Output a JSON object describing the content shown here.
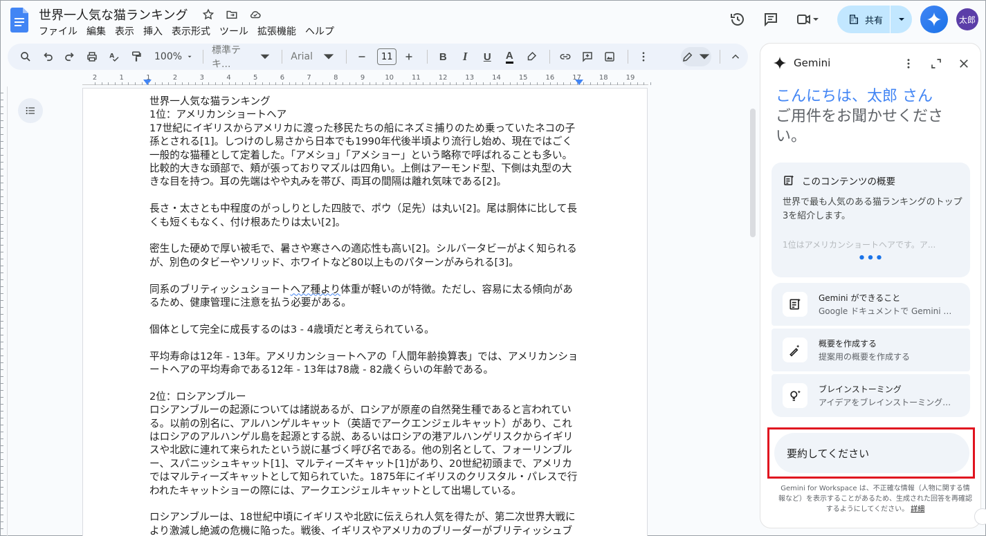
{
  "doc": {
    "title": "世界一人気な猫ランキング",
    "menu": [
      "ファイル",
      "編集",
      "表示",
      "挿入",
      "表示形式",
      "ツール",
      "拡張機能",
      "ヘルプ"
    ]
  },
  "header": {
    "share_label": "共有",
    "avatar_label": "太郎"
  },
  "toolbar": {
    "zoom": "100%",
    "style": "標準テキ...",
    "font": "Arial",
    "font_size": "11",
    "bold": "B",
    "italic": "I",
    "underline": "U",
    "text_color": "A"
  },
  "ruler": {
    "numbers": [
      "2",
      "1",
      "1",
      "2",
      "3",
      "4",
      "5",
      "6",
      "7",
      "8",
      "9",
      "10",
      "11",
      "12",
      "13",
      "14",
      "15",
      "16",
      "17",
      "18",
      "19"
    ]
  },
  "content": {
    "paragraphs": [
      "世界一人気な猫ランキング",
      "1位：アメリカンショートヘア",
      "17世紀にイギリスからアメリカに渡った移民たちの船にネズミ捕りのため乗っていたネコの子孫とされる[1]。しつけのし易さから日本でも1990年代後半頃より流行し始め、現在ではごく一般的な猫種として定着した。「アメショ」「アメショー」という略称で呼ばれることも多い。比較的大きな頭部で、頬が張っておりマズルは四角い。上側はアーモンド型、下側は丸型の大きな目を持つ。耳の先端はやや丸みを帯び、両耳の間隔は離れ気味である[2]。",
      "",
      "長さ・太さとも中程度のがっしりとした四肢で、ポウ（足先）は丸い[2]。尾は胴体に比して長くも短くもなく、付け根あたりは太い[2]。",
      "",
      "密生した硬めで厚い被毛で、暑さや寒さへの適応性も高い[2]。シルバータビーがよく知られるが、別色のタビーやソリッド、ホワイトなど80以上ものパターンがみられる[3]。",
      "",
      "同系のブリティッシュショートヘア種より体重が軽いのが特徴。ただし、容易に太る傾向があるため、健康管理に注意を払う必要がある。",
      "",
      "個体として完全に成長するのは3 - 4歳頃だと考えられている。",
      "",
      "平均寿命は12年 - 13年。アメリカンショートヘアの「人間年齢換算表」では、アメリカンショートヘアの平均寿命である12年 - 13年は78歳 - 82歳くらいの年齢である。",
      "",
      "2位：ロシアンブルー",
      "ロシアンブルーの起源については諸説あるが、ロシアが原産の自然発生種であると言われている。以前の別名に、アルハンゲルキャット（英語でアークエンジェルキャット）があり、これはロシアのアルハンゲル島を起源とする説、あるいはロシアの港アルハンゲリスクからイギリスや北欧に連れて来られたという説に基づく呼び名である。他の別名として、フォーリンブルー、スパニッシュキャット[1]、マルティーズキャット[1]があり、20世紀初頭まで、アメリカではマルティーズキャットとして知られていた。1875年にイギリスのクリスタル・パレスで行われたキャットショーの際には、アークエンジェルキャットとして出場している。",
      "",
      "ロシアンブルーは、18世紀中頃にイギリスや北欧に伝えられ人気を得たが、第二次世界大戦により激減し絶滅の危機に陥った。戦後、イギリスやアメリカのブリーダーがブリティッシュブ"
    ]
  },
  "gemini": {
    "title": "Gemini",
    "greeting_name": "こんにちは、太郎 さん",
    "greeting_sub": "ご用件をお聞かせください。",
    "summary_title": "このコンテンツの概要",
    "summary_text": "世界で最も人気のある猫ランキングのトップ3を紹介します。",
    "summary_fade": "1位はアメリカンショートヘアです。ア...",
    "summary_more": "•••",
    "suggestions": [
      {
        "title": "Gemini ができること",
        "sub": "Google ドキュメントで Gemini が..."
      },
      {
        "title": "概要を作成する",
        "sub": "提案用の概要を作成する"
      },
      {
        "title": "ブレインストーミング",
        "sub": "アイデアをブレインストーミングす..."
      }
    ],
    "prompt_value": "要約してください",
    "disclaimer": "Gemini for Workspace は、不正確な情報（人物に関する情報など）を表示することがあるため、生成された回答を再確認するようにしてください。",
    "disclaimer_link": "詳細"
  },
  "colors": {
    "accent": "#4285f4",
    "share_bg": "#c2e7ff",
    "highlight_border": "#e0131f",
    "avatar_bg": "#5b3ea8"
  }
}
